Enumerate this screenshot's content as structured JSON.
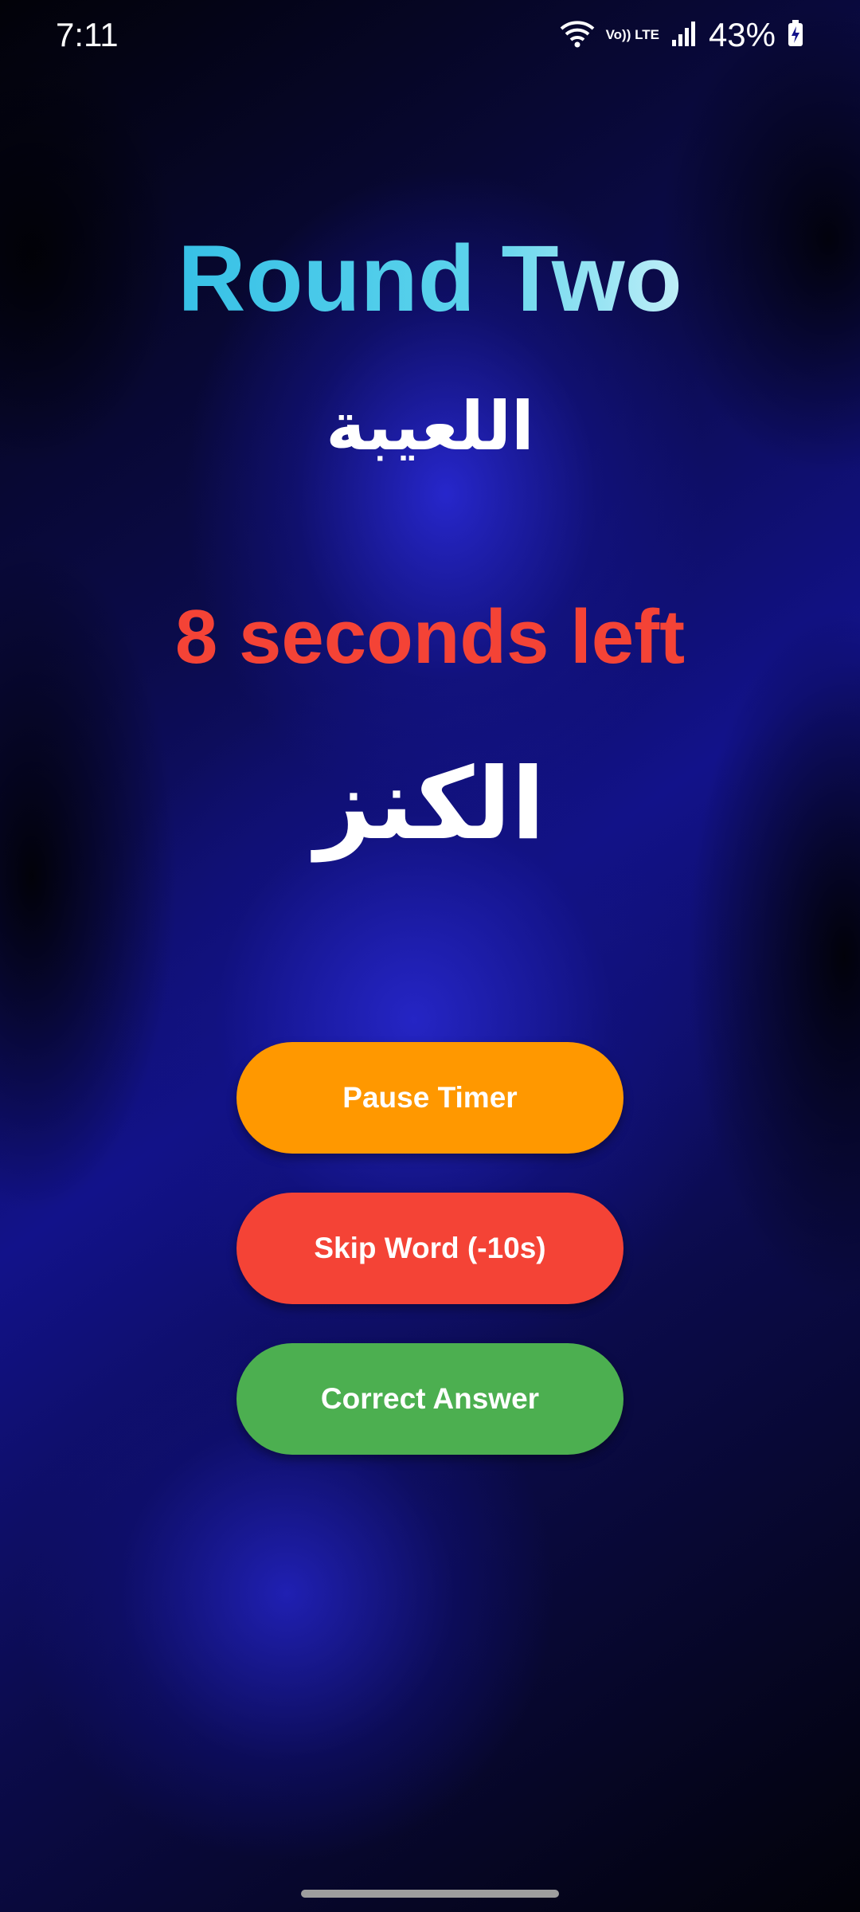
{
  "status_bar": {
    "time": "7:11",
    "network_label": "Vo)) LTE",
    "battery_percent": "43%",
    "icons": [
      "wifi-icon",
      "signal-icon",
      "battery-charging-icon"
    ]
  },
  "game": {
    "round_title": "Round Two",
    "category": "اللعيبة",
    "timer_text": "8 seconds left",
    "current_word": "الكنز"
  },
  "buttons": {
    "pause_label": "Pause Timer",
    "skip_label": "Skip Word (-10s)",
    "correct_label": "Correct Answer"
  },
  "colors": {
    "title_gradient_start": "#36c0e6",
    "title_gradient_end": "#d6f5fa",
    "timer": "#f44336",
    "pause_button": "#ff9800",
    "skip_button": "#f44336",
    "correct_button": "#4caf50",
    "background": "#12128a"
  }
}
